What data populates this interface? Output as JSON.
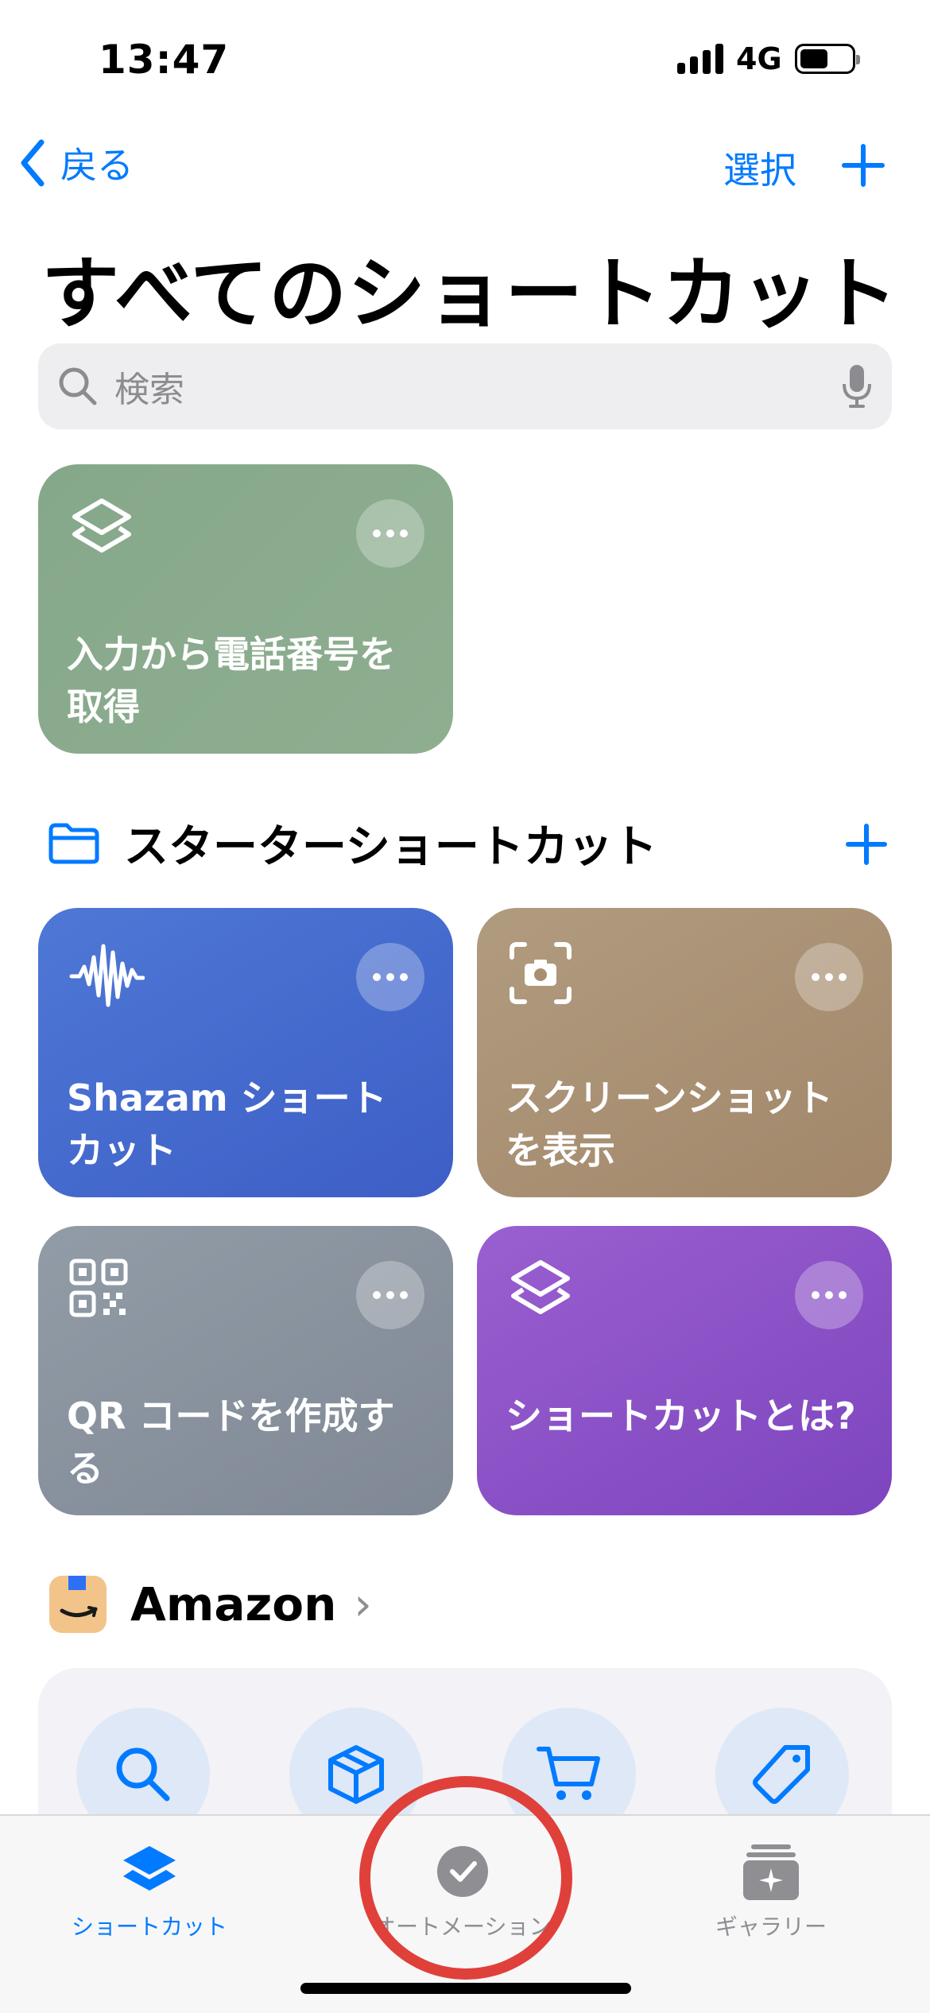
{
  "status": {
    "time": "13:47",
    "network": "4G"
  },
  "nav": {
    "back_label": "戻る",
    "select_label": "選択"
  },
  "page": {
    "title": "すべてのショートカット"
  },
  "search": {
    "placeholder": "検索"
  },
  "top_card": {
    "label": "入力から電話番号を取得",
    "color": "#8aab8d",
    "icon": "layers-icon"
  },
  "starter_section": {
    "title": "スターターショートカット",
    "cards": [
      {
        "label": "Shazam ショートカット",
        "color": "#4a6fd1",
        "icon": "waveform-icon"
      },
      {
        "label": "スクリーンショットを表示",
        "color": "#a98f72",
        "icon": "screenshot-camera-icon"
      },
      {
        "label": "QR コードを作成する",
        "color": "#8a939e",
        "icon": "qrcode-icon"
      },
      {
        "label": "ショートカットとは?",
        "color": "#8a50c6",
        "icon": "layers-icon"
      }
    ]
  },
  "amazon_section": {
    "title": "Amazon",
    "actions": [
      "search-icon",
      "package-icon",
      "cart-icon",
      "tag-icon"
    ]
  },
  "tabbar": {
    "items": [
      {
        "label": "ショートカット",
        "icon": "layers-icon",
        "active": true
      },
      {
        "label": "オートメーション",
        "icon": "automation-check-icon",
        "active": false
      },
      {
        "label": "ギャラリー",
        "icon": "gallery-sparkle-icon",
        "active": false
      }
    ]
  },
  "colors": {
    "accent": "#007aff",
    "annotation": "#e0403a"
  }
}
